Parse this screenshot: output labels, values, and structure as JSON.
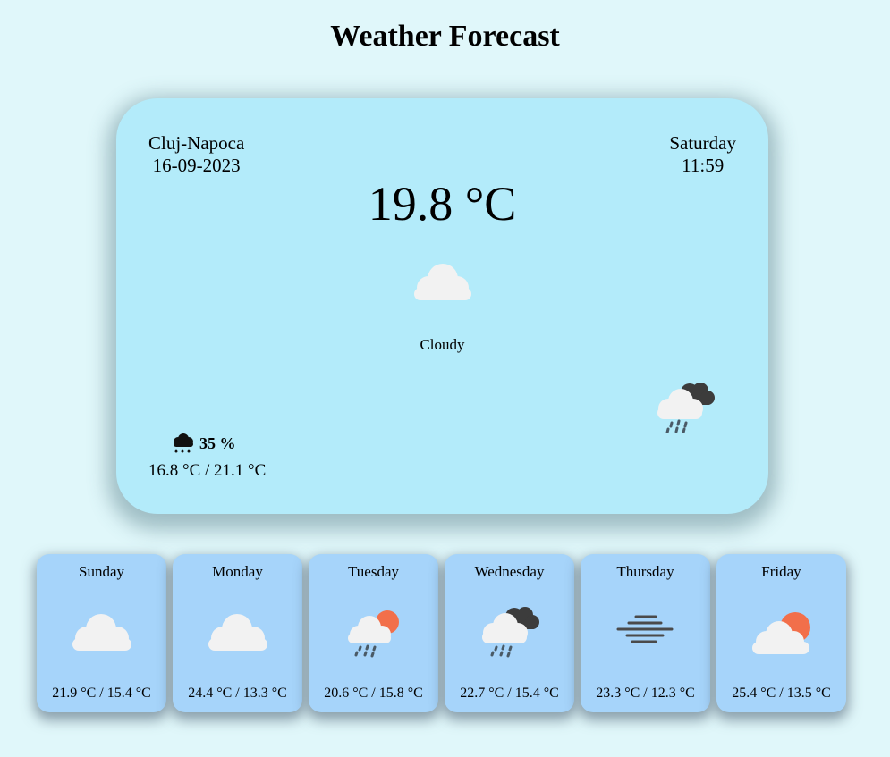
{
  "page": {
    "title": "Weather Forecast"
  },
  "current": {
    "city": "Cluj-Napoca",
    "date": "16-09-2023",
    "day": "Saturday",
    "time": "11:59",
    "temperature": "19.8 °C",
    "condition": "Cloudy",
    "condition_icon": "cloud-icon",
    "side_icon": "rain-cloud-icon",
    "precipitation": "35 %",
    "precipitation_icon": "rain-icon",
    "min_max": "16.8 °C / 21.1 °C"
  },
  "forecast": [
    {
      "day": "Sunday",
      "temps": "21.9 °C / 15.4 °C",
      "icon": "cloud-icon"
    },
    {
      "day": "Monday",
      "temps": "24.4 °C / 13.3 °C",
      "icon": "cloud-icon"
    },
    {
      "day": "Tuesday",
      "temps": "20.6 °C / 15.8 °C",
      "icon": "sun-rain-cloud-icon"
    },
    {
      "day": "Wednesday",
      "temps": "22.7 °C / 15.4 °C",
      "icon": "rain-cloud-icon"
    },
    {
      "day": "Thursday",
      "temps": "23.3 °C / 12.3 °C",
      "icon": "fog-icon"
    },
    {
      "day": "Friday",
      "temps": "25.4 °C / 13.5 °C",
      "icon": "partly-cloudy-icon"
    }
  ],
  "colors": {
    "background": "#e0f7fa",
    "main_card": "#b3ebfa",
    "day_card": "#a6d4fa",
    "sun": "#f26f4a",
    "cloud_light": "#f2f2f2",
    "cloud_dark": "#3c3c3c"
  }
}
